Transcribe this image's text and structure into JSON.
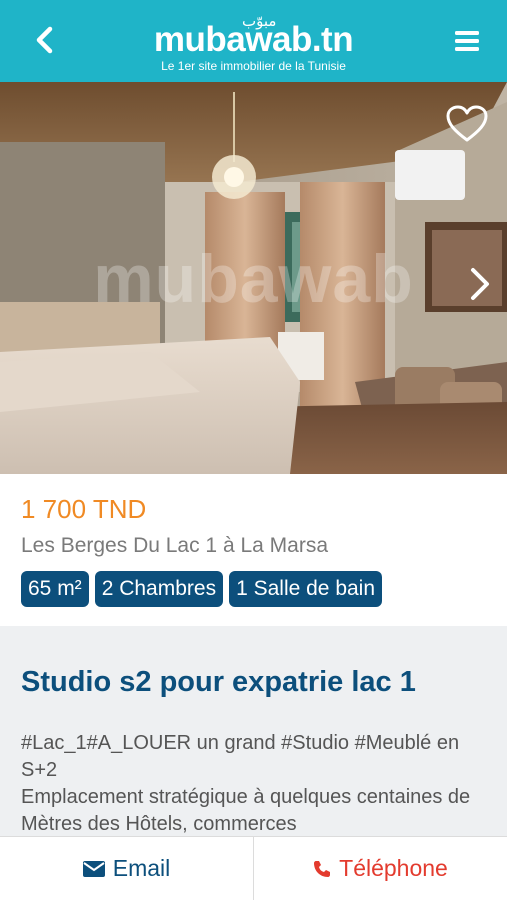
{
  "header": {
    "logo_arabic": "مبوّب",
    "logo_text": "mubawab.tn",
    "tagline": "Le 1er site immobilier de la Tunisie",
    "back_icon": "chevron-left-icon",
    "menu_icon": "hamburger-menu-icon",
    "background_color": "#1fb4c8"
  },
  "photo": {
    "watermark": "mubawab",
    "favorite_icon": "heart-outline-icon",
    "next_icon": "chevron-right-icon"
  },
  "listing": {
    "price": "1 700 TND",
    "location": "Les Berges Du Lac 1 à La Marsa",
    "badges": [
      "65 m²",
      "2 Chambres",
      "1 Salle de bain"
    ],
    "price_color": "#f08a24",
    "badge_color": "#0c4f7c"
  },
  "description": {
    "title": "Studio s2 pour expatrie lac 1",
    "line1": "#Lac_1#A_LOUER un grand #Studio #Meublé en S+2",
    "line2": "Emplacement stratégique à quelques centaines de Mètres des Hôtels, commerces"
  },
  "footer": {
    "email_label": "Email",
    "phone_label": "Téléphone",
    "email_icon": "envelope-icon",
    "phone_icon": "phone-icon",
    "phone_color": "#e33b2e"
  }
}
